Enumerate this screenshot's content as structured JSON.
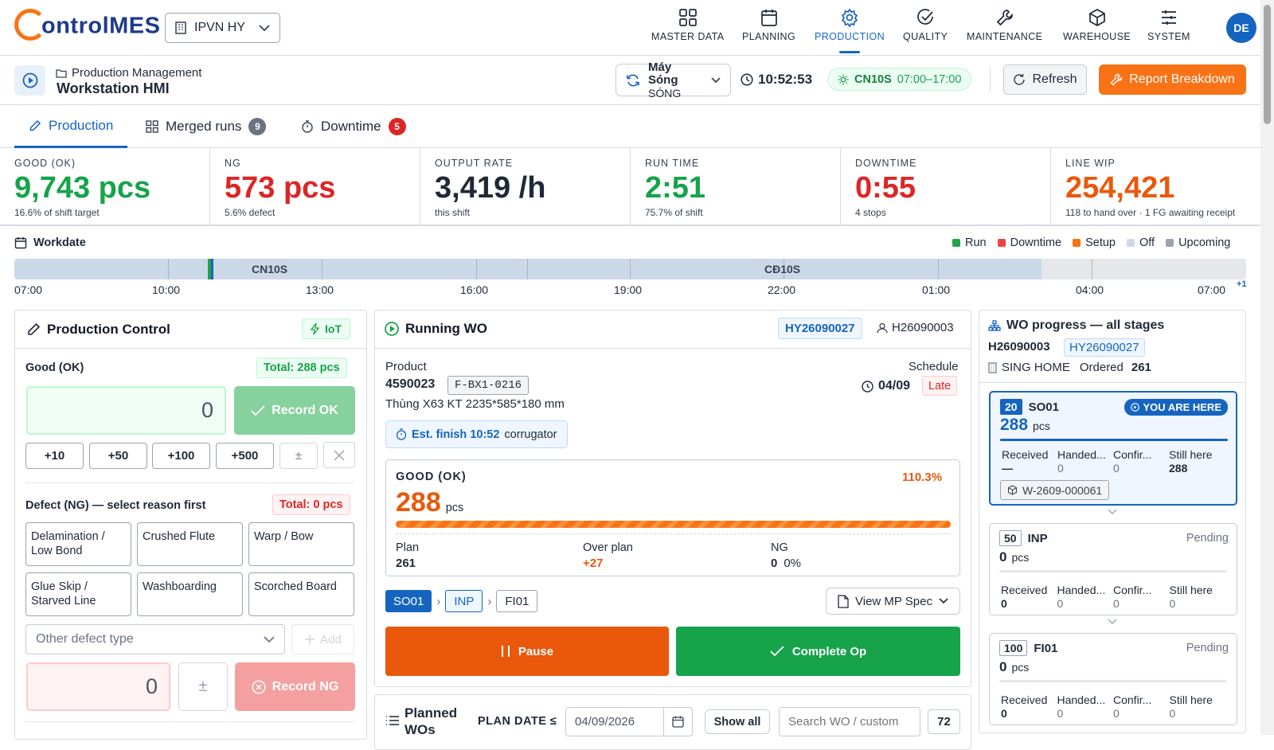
{
  "header": {
    "logo_text": "ontrolMES",
    "plant": "IPVN HY",
    "nav": [
      {
        "label": "MASTER DATA",
        "icon": "grid-icon"
      },
      {
        "label": "PLANNING",
        "icon": "calendar-icon"
      },
      {
        "label": "PRODUCTION",
        "icon": "gear-icon"
      },
      {
        "label": "QUALITY",
        "icon": "check-circle-icon"
      },
      {
        "label": "MAINTENANCE",
        "icon": "wrench-icon"
      },
      {
        "label": "WAREHOUSE",
        "icon": "box-icon"
      },
      {
        "label": "SYSTEM",
        "icon": "sliders-icon"
      }
    ],
    "active_nav": "PRODUCTION",
    "avatar": "DE"
  },
  "subheader": {
    "breadcrumb": "Production Management",
    "title": "Workstation HMI",
    "machine_name": "Máy Sóng",
    "machine_sub": "SÓNG",
    "clock": "10:52:53",
    "shift_code": "CN10S",
    "shift_hours": "07:00–17:00",
    "refresh": "Refresh",
    "report": "Report Breakdown"
  },
  "tabs": [
    {
      "label": "Production",
      "badge": ""
    },
    {
      "label": "Merged runs",
      "badge": "9"
    },
    {
      "label": "Downtime",
      "badge": "5"
    }
  ],
  "kpis": [
    {
      "label": "GOOD (OK)",
      "value": "9,743 pcs",
      "sub": "16.6% of shift target",
      "color": "#16a34a"
    },
    {
      "label": "NG",
      "value": "573 pcs",
      "sub": "5.6% defect",
      "color": "#dc2626"
    },
    {
      "label": "OUTPUT RATE",
      "value": "3,419 /h",
      "sub": "this shift",
      "color": "#1f2937"
    },
    {
      "label": "RUN TIME",
      "value": "2:51",
      "sub": "75.7% of shift",
      "color": "#16a34a"
    },
    {
      "label": "DOWNTIME",
      "value": "0:55",
      "sub": "4 stops",
      "color": "#dc2626"
    },
    {
      "label": "LINE WIP",
      "value": "254,421",
      "sub": "118 to hand over · 1 FG awaiting receipt",
      "color": "#ea580c"
    }
  ],
  "timeline": {
    "title": "Workdate",
    "legend": [
      {
        "label": "Run",
        "color": "#22a34a"
      },
      {
        "label": "Downtime",
        "color": "#ef4444"
      },
      {
        "label": "Setup",
        "color": "#f97316"
      },
      {
        "label": "Off",
        "color": "#d1d9e6"
      },
      {
        "label": "Upcoming",
        "color": "#9ca3af"
      }
    ],
    "shift_labels": [
      "CN10S",
      "CĐ10S"
    ],
    "ticks": [
      "07:00",
      "10:00",
      "13:00",
      "16:00",
      "19:00",
      "22:00",
      "01:00",
      "04:00",
      "07:00"
    ],
    "next_day": "+1"
  },
  "control": {
    "title": "Production Control",
    "iot": "IoT",
    "good_label": "Good (OK)",
    "good_total": "Total: 288 pcs",
    "good_value": "0",
    "record_ok": "Record OK",
    "quick": [
      "+10",
      "+50",
      "+100",
      "+500"
    ],
    "plusminus": "±",
    "ng_label": "Defect (NG) — select reason first",
    "ng_total": "Total: 0 pcs",
    "defects": [
      "Delamination / Low Bond",
      "Crushed Flute",
      "Warp / Bow",
      "Glue Skip / Starved Line",
      "Washboarding",
      "Scorched Board"
    ],
    "other_placeholder": "Other defect type",
    "add": "Add",
    "ng_value": "0",
    "record_ng": "Record NG"
  },
  "running": {
    "title": "Running WO",
    "wo": "HY26090027",
    "user": "H26090003",
    "product_label": "Product",
    "product_code": "4590023",
    "product_chip": "F-BX1-0216",
    "product_desc": "Thùng X63 KT 2235*585*180 mm",
    "schedule_label": "Schedule",
    "schedule_date": "04/09",
    "late": "Late",
    "est_finish": "Est. finish 10:52",
    "est_machine": "corrugator",
    "good_label": "GOOD (OK)",
    "good_pct": "110.3%",
    "good_value": "288",
    "good_unit": "pcs",
    "progress": 1.0,
    "plan_label": "Plan",
    "plan_value": "261",
    "over_label": "Over plan",
    "over_value": "+27",
    "ng_label": "NG",
    "ng_value": "0",
    "ng_pct": "0%",
    "route": [
      "SO01",
      "INP",
      "FI01"
    ],
    "view_spec": "View MP Spec",
    "pause": "Pause",
    "complete": "Complete Op"
  },
  "planned": {
    "title_line1": "Planned",
    "title_line2": "WOs",
    "plan_date_label": "PLAN DATE ≤",
    "plan_date": "04/09/2026",
    "show_all": "Show all",
    "search_placeholder": "Search WO / custom",
    "count": "72"
  },
  "progress": {
    "title": "WO progress — all stages",
    "code": "H26090003",
    "wo": "HY26090027",
    "customer": "SING HOME",
    "ordered_label": "Ordered",
    "ordered_value": "261",
    "col_labels": [
      "Received",
      "Handed...",
      "Confir...",
      "Still here"
    ],
    "stages": [
      {
        "seq": "20",
        "name": "SO01",
        "qty": "288",
        "unit": "pcs",
        "status": "YOU ARE HERE",
        "received": "—",
        "handed": "0",
        "confirmed": "0",
        "still": "288",
        "lot": "W-2609-000061"
      },
      {
        "seq": "50",
        "name": "INP",
        "qty": "0",
        "unit": "pcs",
        "status": "Pending",
        "received": "0",
        "handed": "0",
        "confirmed": "0",
        "still": "0"
      },
      {
        "seq": "100",
        "name": "FI01",
        "qty": "0",
        "unit": "pcs",
        "status": "Pending",
        "received": "0",
        "handed": "0",
        "confirmed": "0",
        "still": "0"
      }
    ]
  }
}
